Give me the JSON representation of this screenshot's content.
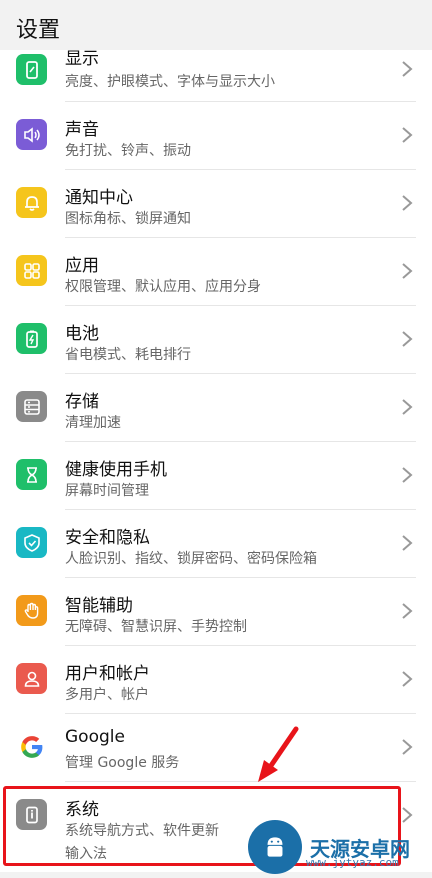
{
  "header": {
    "title": "设置"
  },
  "items": [
    {
      "title": "显示",
      "subtitle": "亮度、护眼模式、字体与显示大小",
      "color": "#1fbf6a",
      "icon": "display-icon"
    },
    {
      "title": "声音",
      "subtitle": "免打扰、铃声、振动",
      "color": "#7b5cd6",
      "icon": "sound-icon"
    },
    {
      "title": "通知中心",
      "subtitle": "图标角标、锁屏通知",
      "color": "#f5c51c",
      "icon": "bell-icon"
    },
    {
      "title": "应用",
      "subtitle": "权限管理、默认应用、应用分身",
      "color": "#f5c51c",
      "icon": "apps-grid-icon"
    },
    {
      "title": "电池",
      "subtitle": "省电模式、耗电排行",
      "color": "#1fbf6a",
      "icon": "battery-icon"
    },
    {
      "title": "存储",
      "subtitle": "清理加速",
      "color": "#8a8a8a",
      "icon": "storage-icon"
    },
    {
      "title": "健康使用手机",
      "subtitle": "屏幕时间管理",
      "color": "#1fbf6a",
      "icon": "hourglass-icon"
    },
    {
      "title": "安全和隐私",
      "subtitle": "人脸识别、指纹、锁屏密码、密码保险箱",
      "color": "#19b8c4",
      "icon": "shield-icon"
    },
    {
      "title": "智能辅助",
      "subtitle": "无障碍、智慧识屏、手势控制",
      "color": "#f29a1a",
      "icon": "hand-icon"
    },
    {
      "title": "用户和帐户",
      "subtitle": "多用户、帐户",
      "color": "#ea5a4e",
      "icon": "user-icon"
    },
    {
      "title": "Google",
      "subtitle": "管理 Google 服务",
      "color": "#ffffff",
      "icon": "google-icon"
    },
    {
      "title": "系统",
      "subtitle": "系统导航方式、软件更新",
      "subtitle2": "输入法",
      "color": "#8a8a8a",
      "icon": "system-info-icon"
    }
  ],
  "watermark": {
    "name": "天源安卓网",
    "url": "www.jytyaz.com"
  }
}
